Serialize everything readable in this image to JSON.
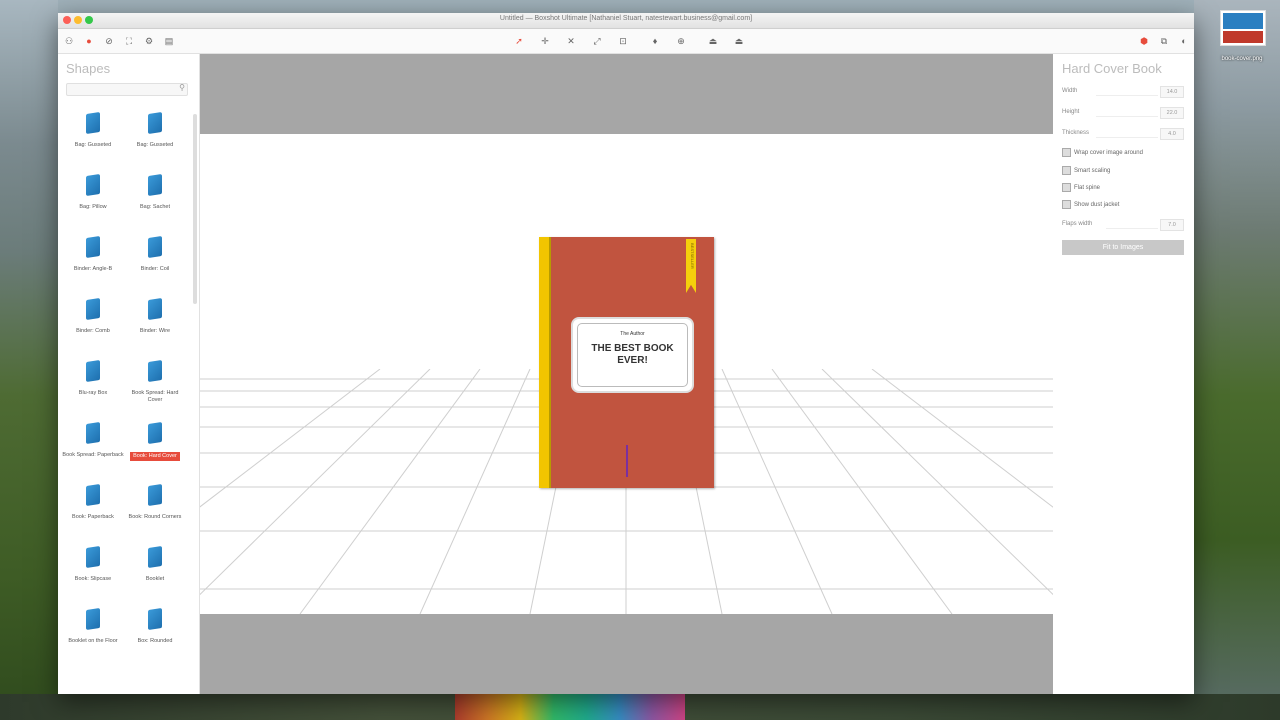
{
  "window": {
    "title": "Untitled — Boxshot Ultimate [Nathaniel Stuart, natestewart.business@gmail.com]"
  },
  "desktop": {
    "icon_label": "book-cover.png"
  },
  "shapes_panel": {
    "title": "Shapes",
    "search_placeholder": "",
    "items": [
      {
        "label": "Bag: Gusseted"
      },
      {
        "label": "Bag: Gusseted"
      },
      {
        "label": "Bag: Pillow"
      },
      {
        "label": "Bag: Sachet"
      },
      {
        "label": "Binder: Angle-B"
      },
      {
        "label": "Binder: Coil"
      },
      {
        "label": "Binder: Comb"
      },
      {
        "label": "Binder: Wire"
      },
      {
        "label": "Blu-ray Box"
      },
      {
        "label": "Book Spread: Hard Cover"
      },
      {
        "label": "Book Spread: Paperback"
      },
      {
        "label": "Book: Hard Cover"
      },
      {
        "label": "Book: Paperback"
      },
      {
        "label": "Book: Round Corners"
      },
      {
        "label": "Book: Slipcase"
      },
      {
        "label": "Booklet"
      },
      {
        "label": "Booklet on the Floor"
      },
      {
        "label": "Box: Rounded"
      }
    ],
    "selected_label": "Book: Hard Cover"
  },
  "book": {
    "author": "The Author",
    "title_line1": "THE BEST BOOK",
    "title_line2": "EVER!",
    "ribbon_text": "BESTSELLER",
    "cover_color": "#c1543f",
    "spine_color": "#f2c500"
  },
  "properties_panel": {
    "title": "Hard Cover Book",
    "width_label": "Width",
    "width_value": "14.0",
    "height_label": "Height",
    "height_value": "22.0",
    "thickness_label": "Thickness",
    "thickness_value": "4.0",
    "check1": "Wrap cover image around",
    "check2": "Smart scaling",
    "check3": "Flat spine",
    "check4": "Show dust jacket",
    "flaps_label": "Flaps width",
    "flaps_value": "7.0",
    "fit_button": "Fit to Images"
  }
}
